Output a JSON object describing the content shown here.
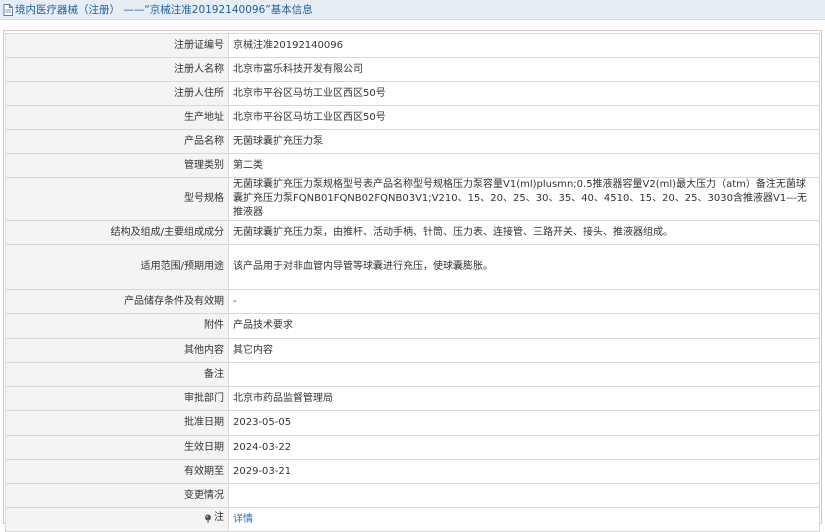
{
  "header": {
    "title": "境内医疗器械（注册） ——“京械注准20192140096”基本信息"
  },
  "rows": [
    {
      "key": "reg_no",
      "label": "注册证编号",
      "value": "京械注准20192140096"
    },
    {
      "key": "registrant",
      "label": "注册人名称",
      "value": "北京市富乐科技开发有限公司"
    },
    {
      "key": "address",
      "label": "注册人住所",
      "value": "北京市平谷区马坊工业区西区50号"
    },
    {
      "key": "production_site",
      "label": "生产地址",
      "value": "北京市平谷区马坊工业区西区50号"
    },
    {
      "key": "product_name",
      "label": "产品名称",
      "value": "无菌球囊扩充压力泵"
    },
    {
      "key": "category",
      "label": "管理类别",
      "value": "第二类"
    },
    {
      "key": "models",
      "label": "型号规格",
      "value": "无菌球囊扩充压力泵规格型号表产品名称型号规格压力泵容量V1(ml)plusmn;0.5推液器容量V2(ml)最大压力（atm）备注无菌球囊扩充压力泵FQNB01FQNB02FQNB03V1;V210、15、20、25、30、35、40、4510、15、20、25、3030含推液器V1---无推液器"
    },
    {
      "key": "structure",
      "label": "结构及组成/主要组成成分",
      "value": "无菌球囊扩充压力泵，由推杆、活动手柄、针筒、压力表、连接管、三路开关、接头、推液器组成。"
    },
    {
      "key": "scope",
      "label": "适用范围/预期用途",
      "value": "该产品用于对非血管内导管等球囊进行充压，使球囊膨胀。"
    },
    {
      "key": "storage",
      "label": "产品储存条件及有效期",
      "value": "-"
    },
    {
      "key": "attachment",
      "label": "附件",
      "value": "产品技术要求"
    },
    {
      "key": "other",
      "label": "其他内容",
      "value": "其它内容"
    },
    {
      "key": "remarks",
      "label": "备注",
      "value": ""
    },
    {
      "key": "approval_dept",
      "label": "审批部门",
      "value": "北京市药品监督管理局"
    },
    {
      "key": "approval_date",
      "label": "批准日期",
      "value": "2023-05-05"
    },
    {
      "key": "effective_date",
      "label": "生效日期",
      "value": "2024-03-22"
    },
    {
      "key": "expiry_date",
      "label": "有效期至",
      "value": "2029-03-21"
    },
    {
      "key": "changes",
      "label": "变更情况",
      "value": ""
    }
  ],
  "note_row": {
    "label": "注",
    "link_text": "详情"
  },
  "icons": {
    "title_icon": "document-icon",
    "note_icon": "pin-icon"
  },
  "colors": {
    "title_text": "#1f5fa0",
    "link": "#2c6eb5",
    "label_bg": "#f4f4f4",
    "title_bar_bg": "#e7edf4"
  }
}
